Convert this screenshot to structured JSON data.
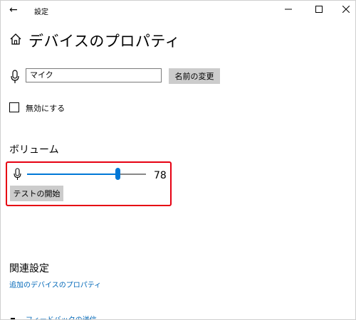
{
  "window": {
    "title": "設定",
    "back_icon": "←",
    "minimize_icon": "—",
    "maximize_icon": "☐",
    "close_icon": "✕"
  },
  "page": {
    "title": "デバイスのプロパティ"
  },
  "device": {
    "name_value": "マイク",
    "rename_label": "名前の変更",
    "disable_label": "無効にする",
    "disable_checked": false
  },
  "volume": {
    "heading": "ボリューム",
    "level": 78,
    "value_text": "78",
    "test_button_label": "テストの開始",
    "accent_color": "#0078d7",
    "highlight_color": "#e60012"
  },
  "related": {
    "heading": "関連設定",
    "link_label": "追加のデバイスのプロパティ",
    "feedback_label": "フィードバックの送信"
  }
}
